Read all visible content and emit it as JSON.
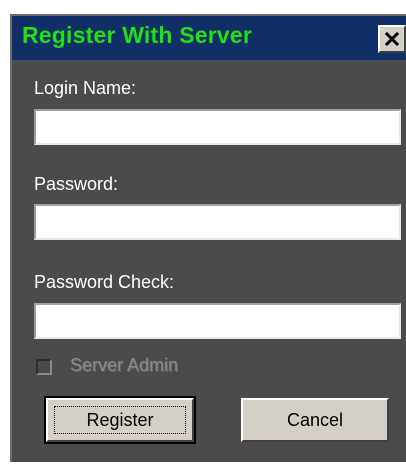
{
  "dialog": {
    "title": "Register With Server",
    "close_icon": "close-icon",
    "colors": {
      "title_text": "#22e014",
      "title_bar": "#0f2f66",
      "body": "#4b4b4b"
    }
  },
  "form": {
    "login_label": "Login Name:",
    "login_value": "",
    "password_label": "Password:",
    "password_value": "",
    "password_check_label": "Password Check:",
    "password_check_value": "",
    "server_admin_label": "Server Admin",
    "server_admin_checked": false
  },
  "buttons": {
    "register_label": "Register",
    "cancel_label": "Cancel"
  }
}
